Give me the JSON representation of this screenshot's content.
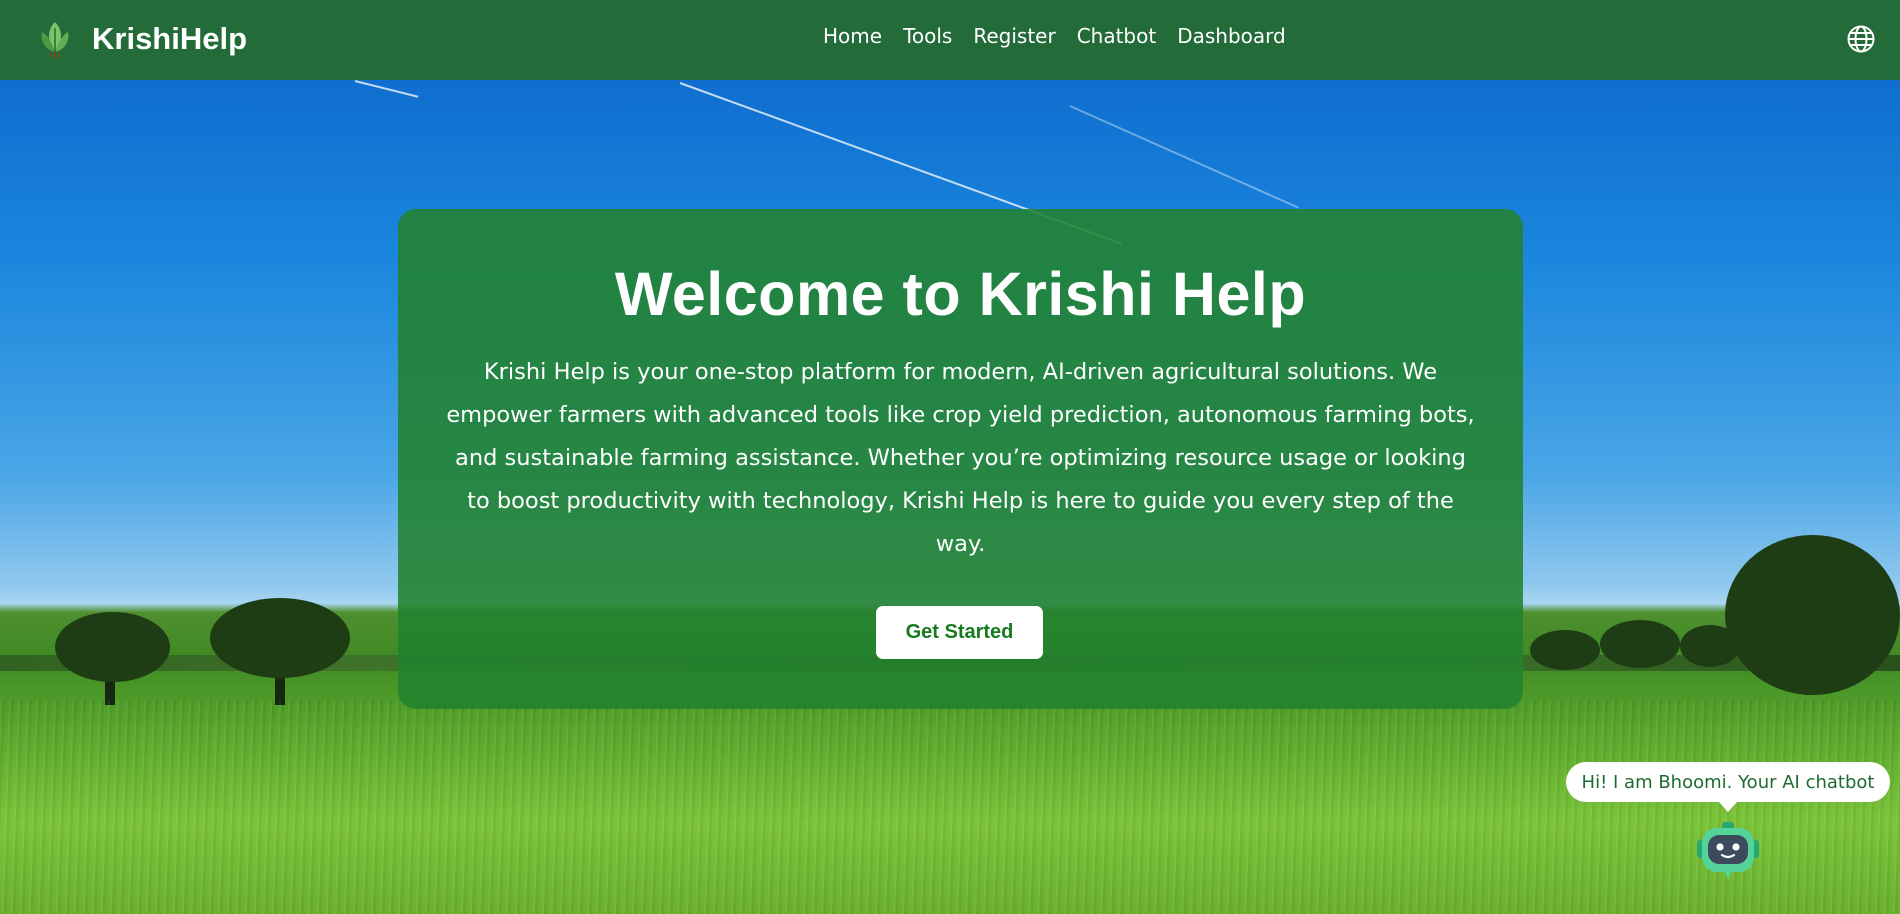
{
  "nav": {
    "brand": "KrishiHelp",
    "links": [
      "Home",
      "Tools",
      "Register",
      "Chatbot",
      "Dashboard"
    ]
  },
  "hero": {
    "title": "Welcome to Krishi Help",
    "description": "Krishi Help is your one-stop platform for modern, AI-driven agricultural solutions. We empower farmers with advanced tools like crop yield prediction, autonomous farming bots, and sustainable farming assistance. Whether you’re optimizing resource usage or looking to boost productivity with technology, Krishi Help is here to guide you every step of the way.",
    "cta_label": "Get Started"
  },
  "chatbot": {
    "greeting": "Hi! I am Bhoomi. Your AI chatbot"
  },
  "icons": {
    "logo": "leaf-logo-icon",
    "language": "globe-icon",
    "chatbot": "robot-icon"
  },
  "colors": {
    "navbar": "#236b38",
    "card": "#22822e",
    "cta_text": "#167a1f"
  }
}
